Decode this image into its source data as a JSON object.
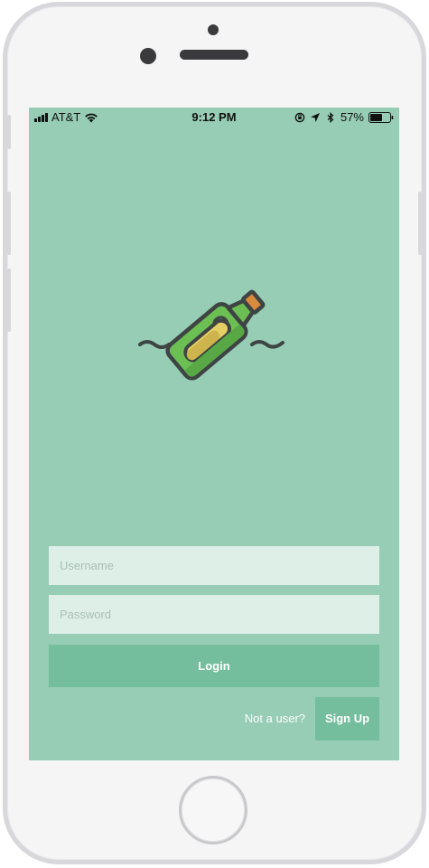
{
  "status_bar": {
    "carrier": "AT&T",
    "time": "9:12 PM",
    "battery": "57%",
    "icons": [
      "signal-icon",
      "wifi-icon",
      "lock-rotation-icon",
      "location-arrow-icon",
      "bluetooth-icon",
      "battery-icon"
    ]
  },
  "logo": {
    "icon": "message-in-a-bottle-icon"
  },
  "form": {
    "username_placeholder": "Username",
    "password_placeholder": "Password",
    "login_label": "Login"
  },
  "signup": {
    "prompt": "Not a user?",
    "button_label": "Sign Up"
  },
  "colors": {
    "background": "#96cdb4",
    "button": "#74be9d",
    "input": "#deefe7",
    "bottle_green": "#6cbf53",
    "paper": "#e3cf63",
    "cork": "#d98a3d",
    "outline": "#3e4444"
  }
}
